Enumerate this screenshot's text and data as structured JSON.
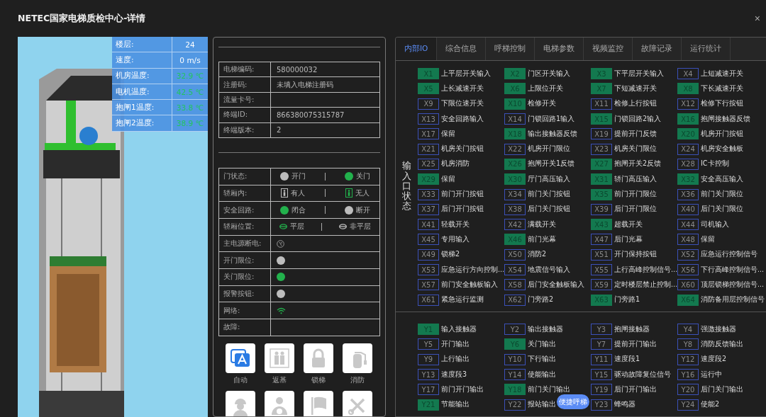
{
  "window": {
    "title": "NETEC国家电梯质检中心-详情",
    "close": "×"
  },
  "info": [
    {
      "label": "楼层:",
      "value": "24"
    },
    {
      "label": "速度:",
      "value": "0 m/s"
    },
    {
      "label": "机房温度:",
      "value": "32.9 ℃",
      "color": "#22c55e"
    },
    {
      "label": "电机温度:",
      "value": "42.5 ℃",
      "color": "#22c55e"
    },
    {
      "label": "抱闸1温度:",
      "value": "33.8 ℃",
      "color": "#22c55e"
    },
    {
      "label": "抱闸2温度:",
      "value": "38.9 ℃",
      "color": "#22c55e"
    }
  ],
  "basic_rows": [
    {
      "label": "电梯编码:",
      "value": "580000032"
    },
    {
      "label": "注册码:",
      "value": "未填入电梯注册码"
    },
    {
      "label": "流量卡号:"
    },
    {
      "label": "终端ID:",
      "value": "866380075315787"
    },
    {
      "label": "终端版本:",
      "value": "2"
    }
  ],
  "status_rows": [
    {
      "label": "门状态:",
      "kind": "pair_dot",
      "options": [
        {
          "text": "开门",
          "on": false
        },
        {
          "text": "关门",
          "on": true
        }
      ]
    },
    {
      "label": "轿厢内:",
      "kind": "pair_person",
      "options": [
        {
          "text": "有人",
          "on": false
        },
        {
          "text": "无人",
          "on": true
        }
      ]
    },
    {
      "label": "安全回路:",
      "kind": "pair_dot",
      "options": [
        {
          "text": "闭合",
          "on": true
        },
        {
          "text": "断开",
          "on": false
        }
      ]
    },
    {
      "label": "轿厢位置:",
      "kind": "pair_level",
      "options": [
        {
          "text": "平层",
          "on": true
        },
        {
          "text": "非平层",
          "on": false
        }
      ]
    },
    {
      "label": "主电源断电:",
      "kind": "power",
      "on": false
    },
    {
      "label": "开门限位:",
      "kind": "dot",
      "on": false
    },
    {
      "label": "关门限位:",
      "kind": "dot",
      "on": true
    },
    {
      "label": "报警按钮:",
      "kind": "dot",
      "on": false
    },
    {
      "label": "网络:",
      "kind": "wifi",
      "on": true
    },
    {
      "label": "故障:",
      "kind": "empty"
    }
  ],
  "modes": [
    {
      "kind": "auto",
      "label": "自动",
      "selected": true
    },
    {
      "kind": "persons",
      "label": "返基",
      "selected": false
    },
    {
      "kind": "lock",
      "label": "锁梯",
      "selected": false
    },
    {
      "kind": "extinguisher",
      "label": "消防",
      "selected": false
    },
    {
      "kind": "worker",
      "selected": false
    },
    {
      "kind": "driver",
      "selected": false
    },
    {
      "kind": "flag",
      "selected": false
    },
    {
      "kind": "tools",
      "selected": false
    }
  ],
  "tabs": [
    {
      "label": "内部IO",
      "selected": true
    },
    {
      "label": "综合信息",
      "selected": false
    },
    {
      "label": "呼梯控制",
      "selected": false
    },
    {
      "label": "电梯参数",
      "selected": false
    },
    {
      "label": "视频监控",
      "selected": false
    },
    {
      "label": "故障记录",
      "selected": false
    },
    {
      "label": "运行统计",
      "selected": false
    }
  ],
  "inputs_title": "输入口状态",
  "inputs": [
    {
      "code": "X1",
      "label": "上平层开关输入",
      "on": true
    },
    {
      "code": "X2",
      "label": "门区开关输入",
      "on": true
    },
    {
      "code": "X3",
      "label": "下平层开关输入",
      "on": true
    },
    {
      "code": "X4",
      "label": "上短减速开关",
      "on": false
    },
    {
      "code": "X5",
      "label": "上长减速开关",
      "on": true
    },
    {
      "code": "X6",
      "label": "上限位开关",
      "on": true
    },
    {
      "code": "X7",
      "label": "下短减速开关",
      "on": true
    },
    {
      "code": "X8",
      "label": "下长减速开关",
      "on": true
    },
    {
      "code": "X9",
      "label": "下限位速开关",
      "on": false
    },
    {
      "code": "X10",
      "label": "检修开关",
      "on": true
    },
    {
      "code": "X11",
      "label": "检修上行按钮",
      "on": false
    },
    {
      "code": "X12",
      "label": "检修下行按钮",
      "on": false
    },
    {
      "code": "X13",
      "label": "安全回路输入",
      "on": false
    },
    {
      "code": "X14",
      "label": "门锁回路1输入",
      "on": false
    },
    {
      "code": "X15",
      "label": "门锁回路2输入",
      "on": true
    },
    {
      "code": "X16",
      "label": "抱闸接触器反馈",
      "on": true
    },
    {
      "code": "X17",
      "label": "保留",
      "on": false
    },
    {
      "code": "X18",
      "label": "输出接触器反馈",
      "on": true
    },
    {
      "code": "X19",
      "label": "提前开门反馈",
      "on": false
    },
    {
      "code": "X20",
      "label": "机房开门按钮",
      "on": true
    },
    {
      "code": "X21",
      "label": "机房关门按钮",
      "on": false
    },
    {
      "code": "X22",
      "label": "机房开门限位",
      "on": false
    },
    {
      "code": "X23",
      "label": "机房关门限位",
      "on": false
    },
    {
      "code": "X24",
      "label": "机房安全触板",
      "on": false
    },
    {
      "code": "X25",
      "label": "机房消防",
      "on": false
    },
    {
      "code": "X26",
      "label": "抱闸开关1反馈",
      "on": true
    },
    {
      "code": "X27",
      "label": "抱闸开关2反馈",
      "on": true
    },
    {
      "code": "X28",
      "label": "IC卡控制",
      "on": false
    },
    {
      "code": "X29",
      "label": "保留",
      "on": true
    },
    {
      "code": "X30",
      "label": "厅门高压输入",
      "on": true
    },
    {
      "code": "X31",
      "label": "轿门高压输入",
      "on": true
    },
    {
      "code": "X32",
      "label": "安全高压输入",
      "on": true
    },
    {
      "code": "X33",
      "label": "前门开门按钮",
      "on": false
    },
    {
      "code": "X34",
      "label": "前门关门按钮",
      "on": false
    },
    {
      "code": "X35",
      "label": "前门开门限位",
      "on": true
    },
    {
      "code": "X36",
      "label": "前门关门限位",
      "on": false
    },
    {
      "code": "X37",
      "label": "后门开门按钮",
      "on": false
    },
    {
      "code": "X38",
      "label": "后门关门按钮",
      "on": false
    },
    {
      "code": "X39",
      "label": "后门开门限位",
      "on": false
    },
    {
      "code": "X40",
      "label": "后门关门限位",
      "on": false
    },
    {
      "code": "X41",
      "label": "轻载开关",
      "on": false
    },
    {
      "code": "X42",
      "label": "满载开关",
      "on": false
    },
    {
      "code": "X43",
      "label": "超载开关",
      "on": true
    },
    {
      "code": "X44",
      "label": "司机输入",
      "on": false
    },
    {
      "code": "X45",
      "label": "专用输入",
      "on": false
    },
    {
      "code": "X46",
      "label": "前门光幕",
      "on": true
    },
    {
      "code": "X47",
      "label": "后门光幕",
      "on": false
    },
    {
      "code": "X48",
      "label": "保留",
      "on": false
    },
    {
      "code": "X49",
      "label": "锁梯2",
      "on": false
    },
    {
      "code": "X50",
      "label": "消防2",
      "on": false
    },
    {
      "code": "X51",
      "label": "开门保持按钮",
      "on": false
    },
    {
      "code": "X52",
      "label": "应急运行控制信号",
      "on": false
    },
    {
      "code": "X53",
      "label": "应急运行方向控制...",
      "on": false
    },
    {
      "code": "X54",
      "label": "地震信号输入",
      "on": false
    },
    {
      "code": "X55",
      "label": "上行高峰控制信号...",
      "on": false
    },
    {
      "code": "X56",
      "label": "下行高峰控制信号...",
      "on": false
    },
    {
      "code": "X57",
      "label": "前门安全触板输入",
      "on": false
    },
    {
      "code": "X58",
      "label": "后门安全触板输入",
      "on": false
    },
    {
      "code": "X59",
      "label": "定时楼层禁止控制...",
      "on": false
    },
    {
      "code": "X60",
      "label": "顶层锁梯控制信号...",
      "on": false
    },
    {
      "code": "X61",
      "label": "紧急运行监测",
      "on": false
    },
    {
      "code": "X62",
      "label": "门旁路2",
      "on": false
    },
    {
      "code": "X63",
      "label": "门旁路1",
      "on": true
    },
    {
      "code": "X64",
      "label": "消防备用层控制信号",
      "on": true
    }
  ],
  "outputs": [
    {
      "code": "Y1",
      "label": "输入接触器",
      "on": true
    },
    {
      "code": "Y2",
      "label": "输出接触器",
      "on": false
    },
    {
      "code": "Y3",
      "label": "抱闸接触器",
      "on": false
    },
    {
      "code": "Y4",
      "label": "强激接触器",
      "on": false
    },
    {
      "code": "Y5",
      "label": "开门输出",
      "on": false
    },
    {
      "code": "Y6",
      "label": "关门输出",
      "on": true
    },
    {
      "code": "Y7",
      "label": "提前开门输出",
      "on": false
    },
    {
      "code": "Y8",
      "label": "消防反馈输出",
      "on": false
    },
    {
      "code": "Y9",
      "label": "上行输出",
      "on": false
    },
    {
      "code": "Y10",
      "label": "下行输出",
      "on": false
    },
    {
      "code": "Y11",
      "label": "速度段1",
      "on": false
    },
    {
      "code": "Y12",
      "label": "速度段2",
      "on": false
    },
    {
      "code": "Y13",
      "label": "速度段3",
      "on": false
    },
    {
      "code": "Y14",
      "label": "使能输出",
      "on": false
    },
    {
      "code": "Y15",
      "label": "驱动故障复位信号",
      "on": false
    },
    {
      "code": "Y16",
      "label": "运行中",
      "on": false
    },
    {
      "code": "Y17",
      "label": "前门开门输出",
      "on": false
    },
    {
      "code": "Y18",
      "label": "前门关门输出",
      "on": true
    },
    {
      "code": "Y19",
      "label": "后门开门输出",
      "on": false
    },
    {
      "code": "Y20",
      "label": "后门关门输出",
      "on": false
    },
    {
      "code": "Y21",
      "label": "节能输出",
      "on": true
    },
    {
      "code": "Y22",
      "label": "报站输出",
      "on": false
    },
    {
      "code": "Y23",
      "label": "蜂鸣器",
      "on": false
    },
    {
      "code": "Y24",
      "label": "使能2",
      "on": false
    }
  ],
  "quick_call": "便捷呼梯"
}
